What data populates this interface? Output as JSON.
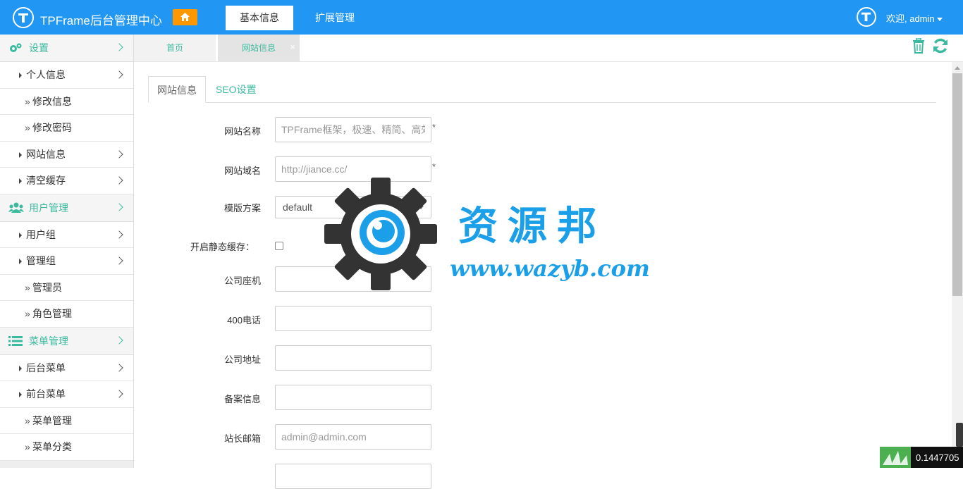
{
  "header": {
    "brand": "TPFrame后台管理中心",
    "tabs": [
      {
        "label": "基本信息",
        "active": true
      },
      {
        "label": "扩展管理",
        "active": false
      }
    ],
    "user_greeting": "欢迎, admin"
  },
  "sidebar": {
    "groups": [
      {
        "label": "设置",
        "icon": "gears-icon",
        "items": [
          {
            "label": "个人信息",
            "level": 1
          },
          {
            "label": "修改信息",
            "level": 2
          },
          {
            "label": "修改密码",
            "level": 2
          },
          {
            "label": "网站信息",
            "level": 1
          },
          {
            "label": "清空缓存",
            "level": 1
          }
        ]
      },
      {
        "label": "用户管理",
        "icon": "users-icon",
        "items": [
          {
            "label": "用户组",
            "level": 1
          },
          {
            "label": "管理组",
            "level": 1
          },
          {
            "label": "管理员",
            "level": 2
          },
          {
            "label": "角色管理",
            "level": 2
          }
        ]
      },
      {
        "label": "菜单管理",
        "icon": "list-icon",
        "items": [
          {
            "label": "后台菜单",
            "level": 1
          },
          {
            "label": "前台菜单",
            "level": 1
          },
          {
            "label": "菜单管理",
            "level": 2
          },
          {
            "label": "菜单分类",
            "level": 2
          }
        ]
      }
    ]
  },
  "page_tabs": [
    {
      "label": "首页"
    },
    {
      "label": "网站信息",
      "close": "×"
    }
  ],
  "subtabs": [
    {
      "label": "网站信息",
      "active": true
    },
    {
      "label": "SEO设置",
      "active": false
    }
  ],
  "form": {
    "site_name": {
      "label": "网站名称",
      "placeholder": "TPFrame框架，极速、精简、高效",
      "required": "*"
    },
    "site_domain": {
      "label": "网站域名",
      "placeholder": "http://jiance.cc/",
      "required": "*"
    },
    "template": {
      "label": "模版方案",
      "value": "default"
    },
    "static_cache": {
      "label": "开启静态缓存：",
      "checked": false
    },
    "phone": {
      "label": "公司座机",
      "value": ""
    },
    "hotline": {
      "label": "400电话",
      "value": ""
    },
    "address": {
      "label": "公司地址",
      "value": ""
    },
    "icp": {
      "label": "备案信息",
      "value": ""
    },
    "email": {
      "label": "站长邮箱",
      "placeholder": "admin@admin.com"
    }
  },
  "watermark": {
    "title": "资源邦",
    "url": "www.wazyb.com"
  },
  "corner_readout": "0.1447705",
  "colors": {
    "header_bg": "#2196f3",
    "accent": "#3cba9f",
    "home_button": "#ff9800",
    "watermark_blue": "#1a9fe8"
  }
}
